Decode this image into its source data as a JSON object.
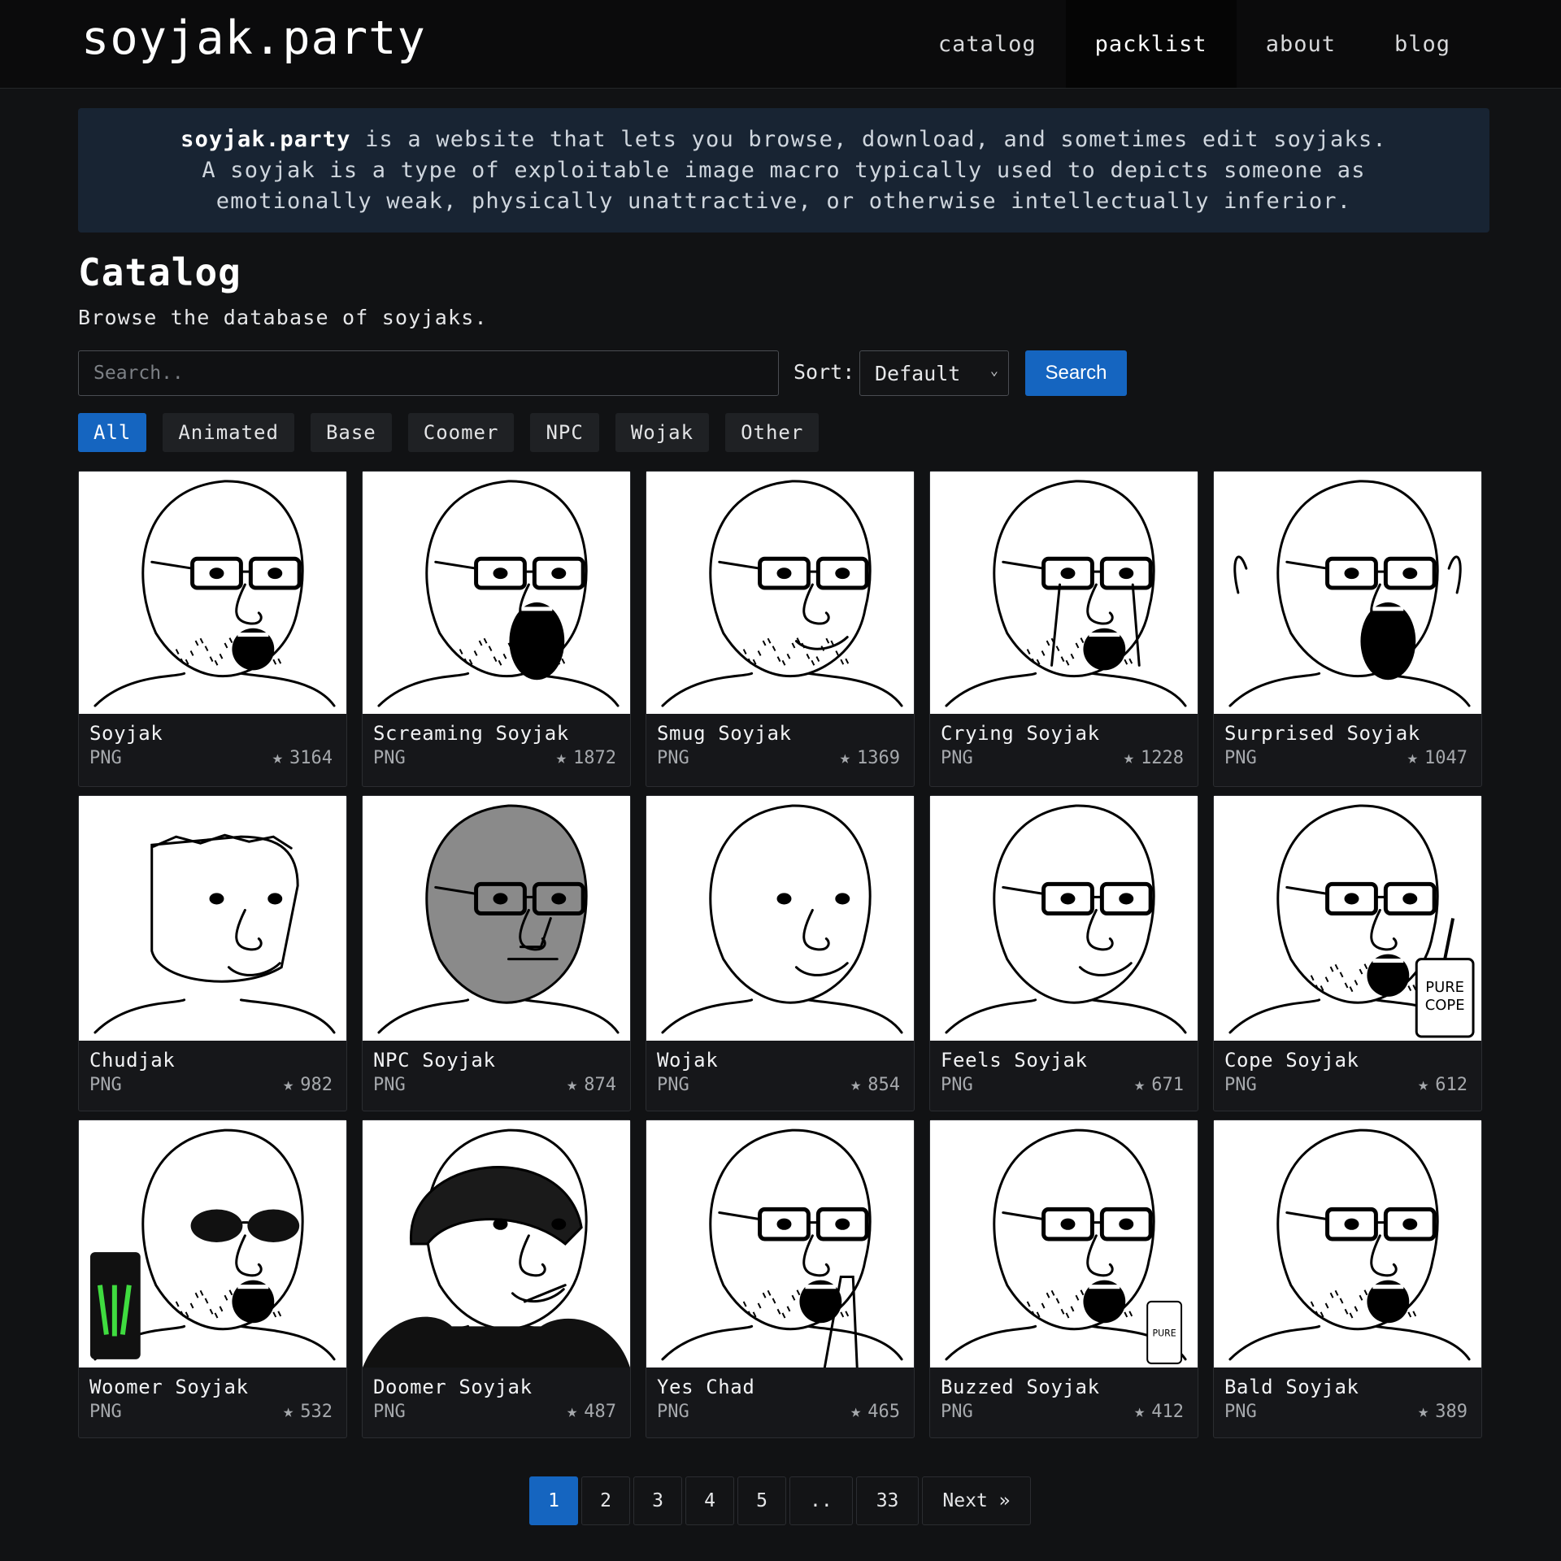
{
  "site": {
    "brand": "soyjak.party",
    "nav": [
      {
        "label": "catalog",
        "active": false
      },
      {
        "label": "packlist",
        "active": true
      },
      {
        "label": "about",
        "active": false
      },
      {
        "label": "blog",
        "active": false
      }
    ]
  },
  "info": {
    "brand_bold": "soyjak.party",
    "line1_rest": " is a website that lets you browse, download, and sometimes edit soyjaks.",
    "line2": "A soyjak is a type of exploitable image macro typically used to depicts someone as",
    "line3": "emotionally weak, physically unattractive, or otherwise intellectually inferior."
  },
  "catalog": {
    "title": "Catalog",
    "subtitle": "Browse the database of soyjaks.",
    "search_placeholder": "Search..",
    "search_value": "",
    "sort_label": "Sort:",
    "sort_value": "Default",
    "search_button": "Search",
    "filters": [
      {
        "label": "All",
        "active": true
      },
      {
        "label": "Animated",
        "active": false
      },
      {
        "label": "Base",
        "active": false
      },
      {
        "label": "Coomer",
        "active": false
      },
      {
        "label": "NPC",
        "active": false
      },
      {
        "label": "Wojak",
        "active": false
      },
      {
        "label": "Other",
        "active": false
      }
    ],
    "items": [
      {
        "name": "Soyjak",
        "type": "PNG",
        "stars": "3164",
        "variant": "soyjak"
      },
      {
        "name": "Screaming Soyjak",
        "type": "PNG",
        "stars": "1872",
        "variant": "scream"
      },
      {
        "name": "Smug Soyjak",
        "type": "PNG",
        "stars": "1369",
        "variant": "smug"
      },
      {
        "name": "Crying Soyjak",
        "type": "PNG",
        "stars": "1228",
        "variant": "crying"
      },
      {
        "name": "Surprised Soyjak",
        "type": "PNG",
        "stars": "1047",
        "variant": "surprised"
      },
      {
        "name": "Chudjak",
        "type": "PNG",
        "stars": "982",
        "variant": "chud"
      },
      {
        "name": "NPC Soyjak",
        "type": "PNG",
        "stars": "874",
        "variant": "npc"
      },
      {
        "name": "Wojak",
        "type": "PNG",
        "stars": "854",
        "variant": "wojak"
      },
      {
        "name": "Feels Soyjak",
        "type": "PNG",
        "stars": "671",
        "variant": "feels"
      },
      {
        "name": "Cope Soyjak",
        "type": "PNG",
        "stars": "612",
        "variant": "cope",
        "prop_text": "PURE COPE"
      },
      {
        "name": "Woomer Soyjak",
        "type": "PNG",
        "stars": "532",
        "variant": "woomer"
      },
      {
        "name": "Doomer Soyjak",
        "type": "PNG",
        "stars": "487",
        "variant": "doomer"
      },
      {
        "name": "Yes Chad",
        "type": "PNG",
        "stars": "465",
        "variant": "yeschad"
      },
      {
        "name": "Buzzed Soyjak",
        "type": "PNG",
        "stars": "412",
        "variant": "buzzed",
        "prop_text": "PURE"
      },
      {
        "name": "Bald Soyjak",
        "type": "PNG",
        "stars": "389",
        "variant": "bald"
      }
    ]
  },
  "pagination": {
    "pages": [
      {
        "label": "1",
        "active": true
      },
      {
        "label": "2",
        "active": false
      },
      {
        "label": "3",
        "active": false
      },
      {
        "label": "4",
        "active": false
      },
      {
        "label": "5",
        "active": false
      },
      {
        "label": "..",
        "active": false
      },
      {
        "label": "33",
        "active": false
      }
    ],
    "next_label": "Next »"
  },
  "colors": {
    "accent": "#1565c0",
    "background": "#111214",
    "info_panel": "#182433",
    "card": "#16171a"
  }
}
